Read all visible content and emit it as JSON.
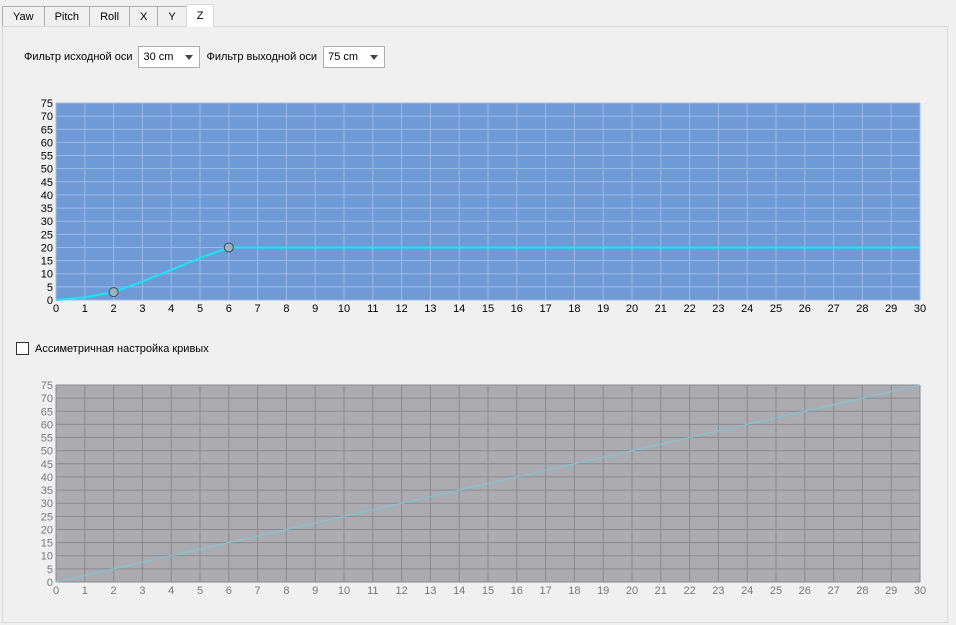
{
  "tabs": [
    {
      "label": "Yaw",
      "active": false
    },
    {
      "label": "Pitch",
      "active": false
    },
    {
      "label": "Roll",
      "active": false
    },
    {
      "label": "X",
      "active": false
    },
    {
      "label": "Y",
      "active": false
    },
    {
      "label": "Z",
      "active": true
    }
  ],
  "filters": {
    "input_label": "Фильтр исходной оси",
    "input_value": "30 cm",
    "output_label": "Фильтр выходной оси",
    "output_value": "75 cm"
  },
  "asymmetric": {
    "label": "Ассиметричная настройка кривых",
    "checked": false
  },
  "colors": {
    "active_bg": "#6f9ad6",
    "active_grid": "#9dbbe6",
    "inactive_bg": "#acacb0",
    "inactive_grid": "#8a8a8e",
    "curve": "#19e6f5",
    "inactive_curve": "#80c6d2",
    "point_fill": "#99b5c4",
    "active_text": "#000000",
    "inactive_text": "#777777"
  },
  "chart_data": [
    {
      "type": "line",
      "active": true,
      "xlim": [
        0,
        30
      ],
      "ylim": [
        0,
        75
      ],
      "xticks": [
        0,
        1,
        2,
        3,
        4,
        5,
        6,
        7,
        8,
        9,
        10,
        11,
        12,
        13,
        14,
        15,
        16,
        17,
        18,
        19,
        20,
        21,
        22,
        23,
        24,
        25,
        26,
        27,
        28,
        29,
        30
      ],
      "yticks": [
        0,
        5,
        10,
        15,
        20,
        25,
        30,
        35,
        40,
        45,
        50,
        55,
        60,
        65,
        70,
        75
      ],
      "grid": true,
      "series": [
        {
          "x": [
            0,
            1,
            2,
            3,
            4,
            5,
            6,
            30
          ],
          "y": [
            0,
            1,
            3,
            7,
            11.5,
            16,
            20,
            20
          ]
        }
      ],
      "control_points": [
        {
          "x": 2,
          "y": 3
        },
        {
          "x": 6,
          "y": 20
        }
      ]
    },
    {
      "type": "line",
      "active": false,
      "xlim": [
        0,
        30
      ],
      "ylim": [
        0,
        75
      ],
      "xticks": [
        0,
        1,
        2,
        3,
        4,
        5,
        6,
        7,
        8,
        9,
        10,
        11,
        12,
        13,
        14,
        15,
        16,
        17,
        18,
        19,
        20,
        21,
        22,
        23,
        24,
        25,
        26,
        27,
        28,
        29,
        30
      ],
      "yticks": [
        0,
        5,
        10,
        15,
        20,
        25,
        30,
        35,
        40,
        45,
        50,
        55,
        60,
        65,
        70,
        75
      ],
      "grid": true,
      "series": [
        {
          "x": [
            0,
            30
          ],
          "y": [
            0,
            75
          ]
        }
      ],
      "control_points": []
    }
  ]
}
